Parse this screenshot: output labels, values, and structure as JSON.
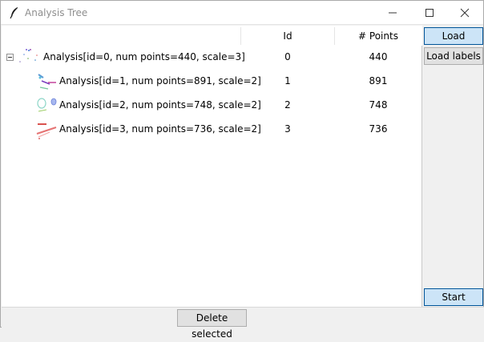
{
  "window": {
    "title": "Analysis Tree"
  },
  "tree": {
    "columns": [
      {
        "label": "Id"
      },
      {
        "label": "# Points"
      }
    ],
    "rows": [
      {
        "label": "Analysis[id=0, num points=440, scale=3]",
        "id": "0",
        "points": "440",
        "expanded": true
      },
      {
        "label": "Analysis[id=1, num points=891, scale=2]",
        "id": "1",
        "points": "891"
      },
      {
        "label": "Analysis[id=2, num points=748, scale=2]",
        "id": "2",
        "points": "748"
      },
      {
        "label": "Analysis[id=3, num points=736, scale=2]",
        "id": "3",
        "points": "736"
      }
    ]
  },
  "buttons": {
    "load": "Load",
    "load_labels": "Load labels",
    "start": "Start",
    "delete_selected": "Delete selected"
  },
  "icons": {
    "app": "feather-icon",
    "minimize": "minimize-icon",
    "maximize": "maximize-icon",
    "close": "close-icon",
    "expand": "minus-box-icon"
  },
  "colors": {
    "button_accent": "#cce4f7",
    "button_border": "#005499",
    "title_text": "#8e8e8e"
  }
}
